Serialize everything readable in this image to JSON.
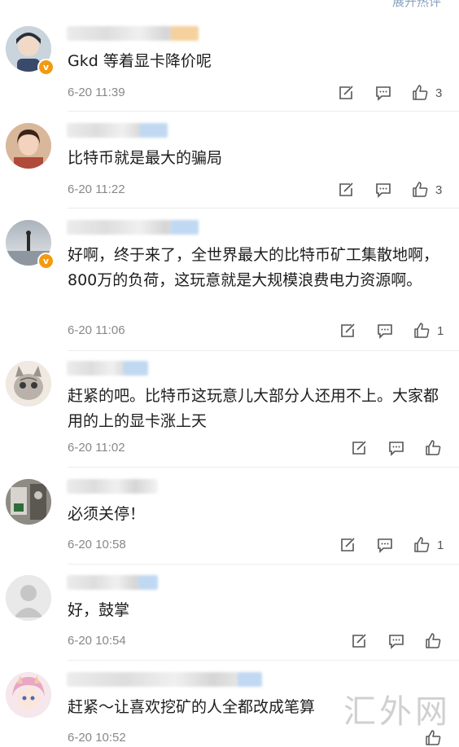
{
  "header": {
    "partial_text": "展开热评"
  },
  "comments": [
    {
      "text": "Gkd 等着显卡降价呢",
      "time": "6-20 11:39",
      "likes": "3",
      "verified": true
    },
    {
      "text": "比特币就是最大的骗局",
      "time": "6-20 11:22",
      "likes": "3",
      "verified": false
    },
    {
      "text": "好啊，终于来了，全世界最大的比特币矿工集散地啊，800万的负荷，这玩意就是大规模浪费电力资源啊。",
      "time": "6-20 11:06",
      "likes": "1",
      "verified": true
    },
    {
      "text": "赶紧的吧。比特币这玩意儿大部分人还用不上。大家都用的上的显卡涨上天",
      "time": "6-20 11:02",
      "likes": "",
      "verified": false
    },
    {
      "text": "必须关停！",
      "time": "6-20 10:58",
      "likes": "1",
      "verified": false
    },
    {
      "text": "好，鼓掌",
      "time": "6-20 10:54",
      "likes": "",
      "verified": false
    },
    {
      "text": "赶紧～让喜欢挖矿的人全都改成笔算",
      "time": "6-20 10:52",
      "likes": "",
      "verified": false
    }
  ],
  "watermark": "汇外网",
  "icons": {
    "repost": "repost-icon",
    "comment": "comment-icon",
    "like": "like-icon",
    "verified": "verified-badge-icon"
  },
  "colors": {
    "badge": "#f29a11",
    "icon": "#555555",
    "time": "#888888"
  }
}
